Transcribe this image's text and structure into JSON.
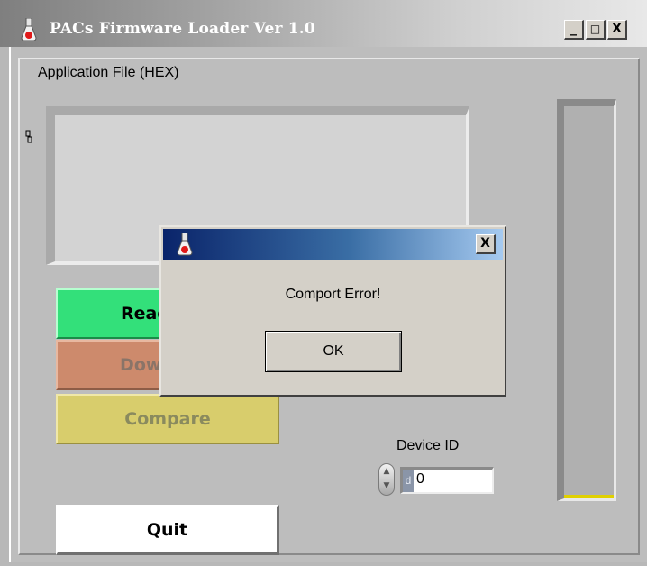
{
  "window": {
    "title": "PACs Firmware Loader Ver 1.0",
    "icon": "flask-app-icon",
    "controls": {
      "minimize": "_",
      "maximize": "□",
      "close": "X"
    }
  },
  "main": {
    "app_file_label": "Application File (HEX)",
    "app_file_value": "",
    "buttons": {
      "read": "Read HEX",
      "download": "Download",
      "compare": "Compare",
      "quit": "Quit"
    },
    "device_id": {
      "label": "Device ID",
      "radix": "d",
      "value": "0"
    },
    "progress": {
      "value": 0.01
    }
  },
  "dialog": {
    "title": "",
    "icon": "flask-app-icon",
    "close": "X",
    "message": "Comport Error!",
    "ok": "OK"
  },
  "colors": {
    "read_button": "#33e07a",
    "download_button": "#cd8a6c",
    "compare_button": "#d8cd6c",
    "dialog_title_start": "#0a246a",
    "dialog_title_end": "#a6caf0",
    "progress_fill": "#e0d000"
  }
}
